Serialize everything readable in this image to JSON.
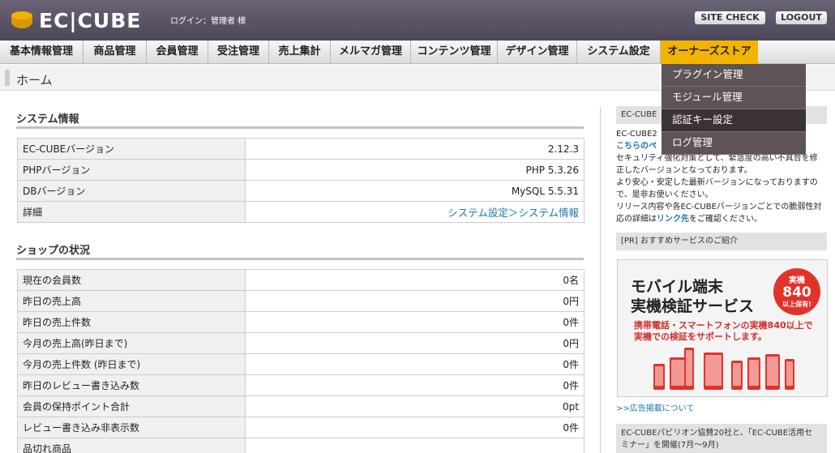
{
  "header": {
    "logo_text": "EC|CUBE",
    "login_info": "ログイン：管理者 様",
    "site_check": "SITE CHECK",
    "logout": "LOGOUT"
  },
  "nav": [
    {
      "label": "基本情報管理"
    },
    {
      "label": "商品管理"
    },
    {
      "label": "会員管理"
    },
    {
      "label": "受注管理"
    },
    {
      "label": "売上集計"
    },
    {
      "label": "メルマガ管理"
    },
    {
      "label": "コンテンツ管理"
    },
    {
      "label": "デザイン管理"
    },
    {
      "label": "システム設定"
    },
    {
      "label": "オーナーズストア"
    }
  ],
  "dropdown": [
    {
      "label": "プラグイン管理"
    },
    {
      "label": "モジュール管理"
    },
    {
      "label": "認証キー設定"
    },
    {
      "label": "ログ管理"
    }
  ],
  "breadcrumb": {
    "title": "ホーム"
  },
  "system_info": {
    "title": "システム情報",
    "rows": [
      {
        "key": "EC-CUBEバージョン",
        "value": "2.12.3"
      },
      {
        "key": "PHPバージョン",
        "value": "PHP 5.3.26"
      },
      {
        "key": "DBバージョン",
        "value": "MySQL 5.5.31"
      },
      {
        "key": "詳細",
        "value": "システム設定＞システム情報"
      }
    ]
  },
  "shop_status": {
    "title": "ショップの状況",
    "rows": [
      {
        "key": "現在の会員数",
        "value": "0名"
      },
      {
        "key": "昨日の売上高",
        "value": "0円"
      },
      {
        "key": "昨日の売上件数",
        "value": "0件"
      },
      {
        "key": "今月の売上高(昨日まで)",
        "value": "0円"
      },
      {
        "key": "今月の売上件数 (昨日まで)",
        "value": "0件"
      },
      {
        "key": "昨日のレビュー書き込み数",
        "value": "0件"
      },
      {
        "key": "会員の保持ポイント合計",
        "value": "0pt"
      },
      {
        "key": "レビュー書き込み非表示数",
        "value": "0件"
      },
      {
        "key": "品切れ商品",
        "value": ""
      }
    ]
  },
  "right": {
    "news_head": "EC-CUBE",
    "news_line1": "EC-CUBE2",
    "news_link1": "こちらのペ",
    "news_line2": "セキュリティ強化対策として、緊急度の高い不具合を修",
    "news_line3": "正したバージョンとなっております。",
    "news_line4": "より安心・安定した最新バージョンになっておりますの",
    "news_line5": "で、是非お使いください。",
    "news_line6": "リリース内容や各EC-CUBEバージョンごとでの脆弱性対",
    "news_line7a": "応の詳細は",
    "news_line7_link": "リンク先",
    "news_line7b": "をご確認ください。",
    "pr_head": "[PR] おすすめサービスのご紹介",
    "banner_t1": "モバイル端末",
    "banner_t2": "実機検証サービス",
    "banner_sub": "携帯電話・スマートフォンの実機840以上で実機での検証をサポートします。",
    "badge_1": "実機",
    "badge_2": "840",
    "badge_3": "以上保有!",
    "ad_link": ">>広告掲載について",
    "bottom_head": "EC-CUBEパビリオン協賛20社と、「EC-CUBE活用セ",
    "bottom_head2": "ミナー」を開催(7月～9月)"
  },
  "colors": {
    "accent": "#f2b400",
    "header": "#5a5364",
    "link": "#1a77b0",
    "banner_red": "#e2332b"
  }
}
